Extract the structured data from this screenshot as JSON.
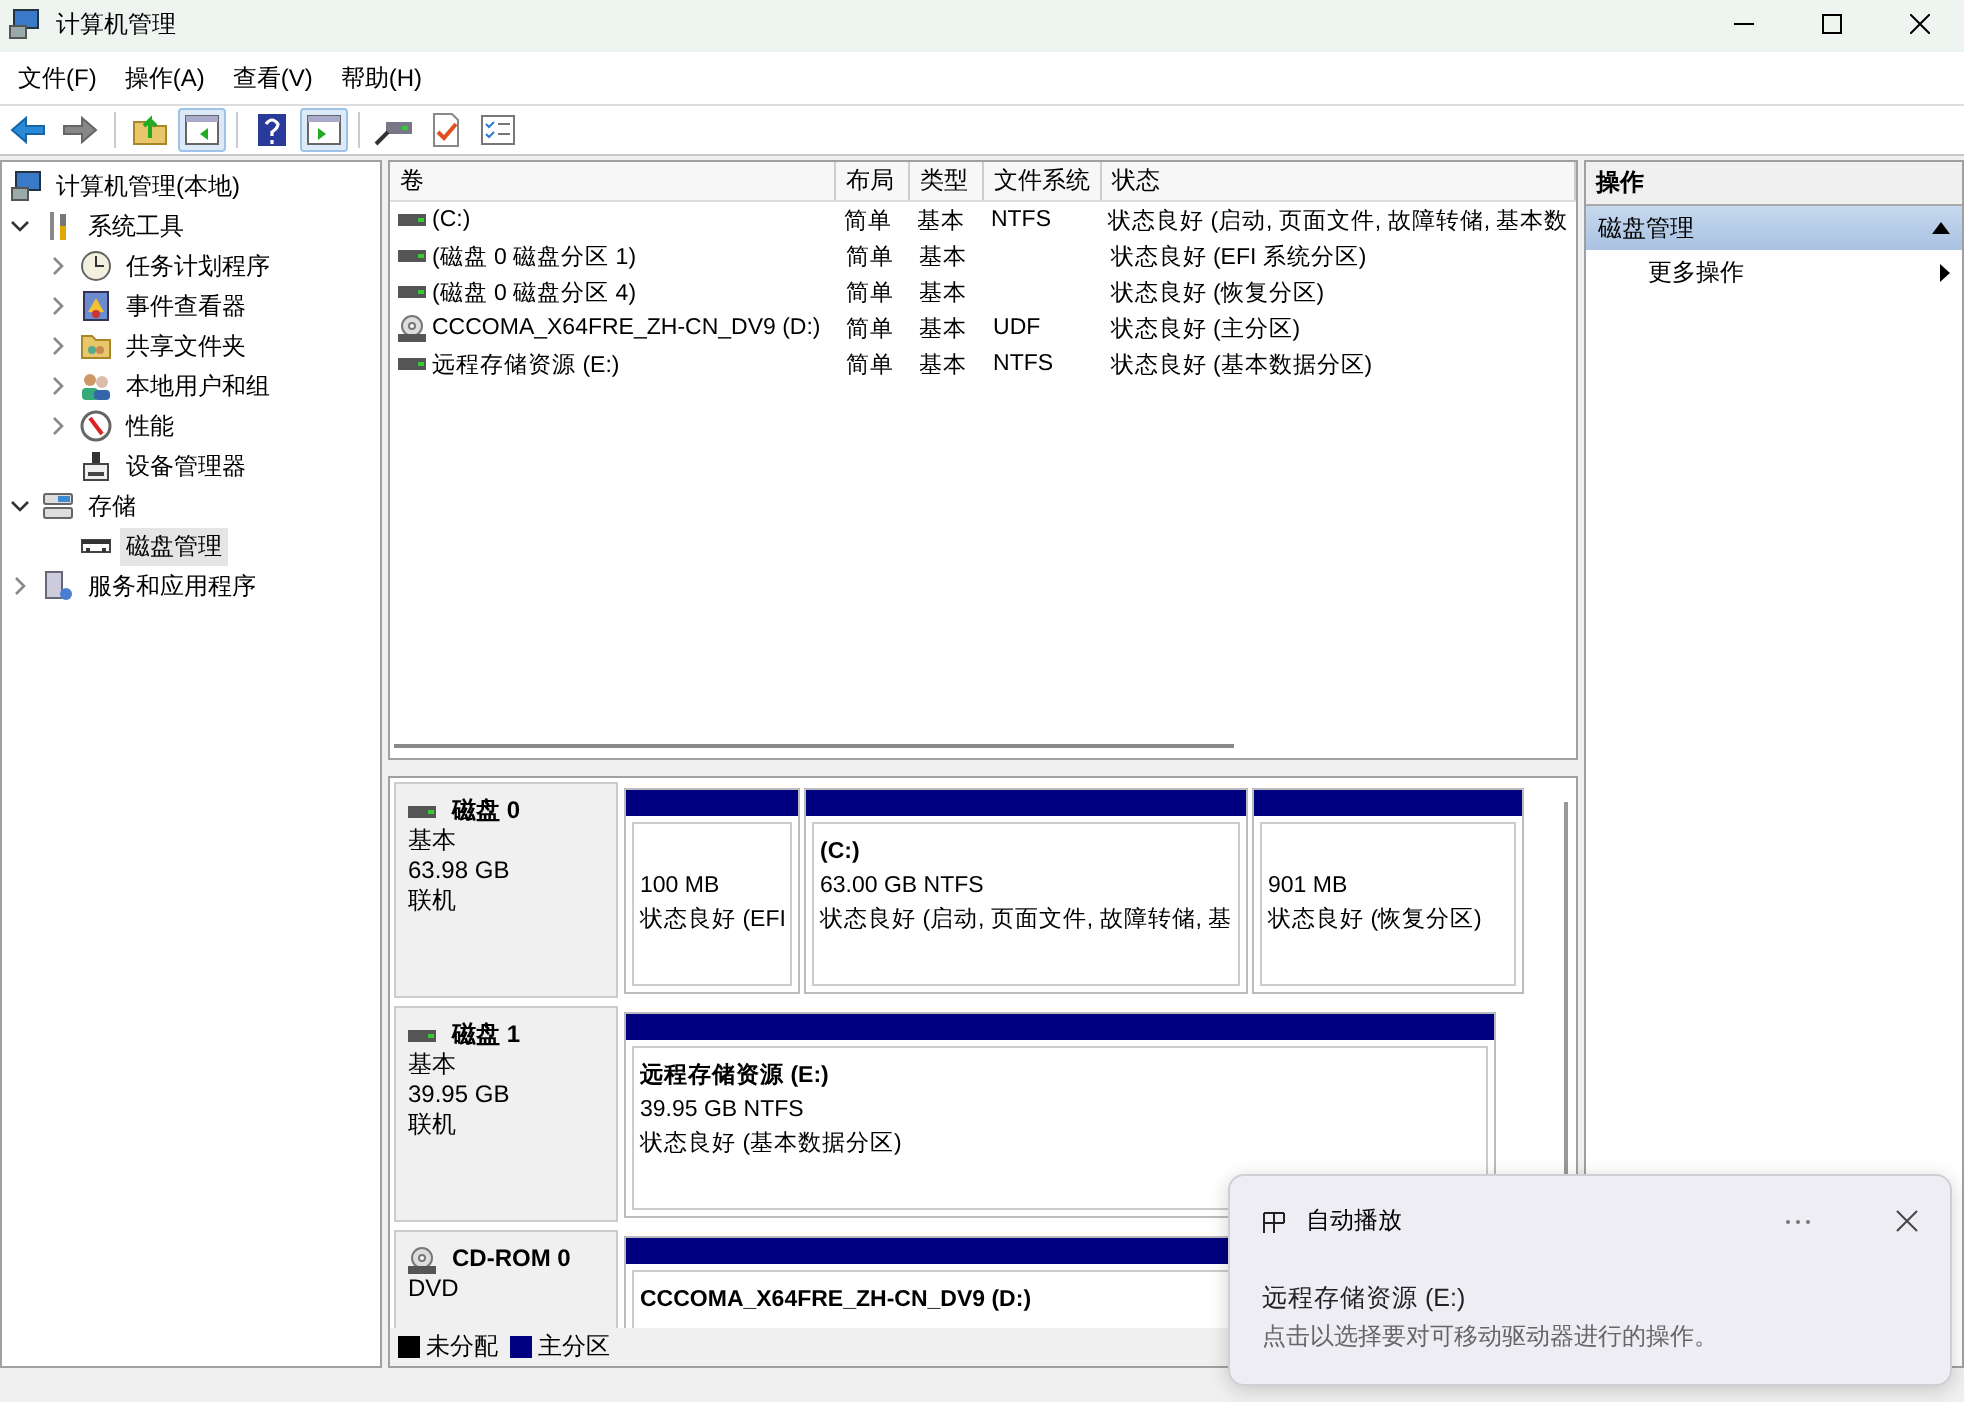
{
  "window": {
    "title": "计算机管理"
  },
  "menu": [
    "文件(F)",
    "操作(A)",
    "查看(V)",
    "帮助(H)"
  ],
  "toolbar": [
    {
      "kind": "back",
      "on": false
    },
    {
      "kind": "forward",
      "on": false
    },
    {
      "kind": "sep"
    },
    {
      "kind": "folder-up",
      "on": false
    },
    {
      "kind": "tree-pane",
      "on": true
    },
    {
      "kind": "sep"
    },
    {
      "kind": "help",
      "on": false
    },
    {
      "kind": "action-pane",
      "on": true
    },
    {
      "kind": "sep"
    },
    {
      "kind": "connect",
      "on": false
    },
    {
      "kind": "check-doc",
      "on": false
    },
    {
      "kind": "checklist",
      "on": false
    }
  ],
  "tree": [
    {
      "label": "计算机管理(本地)",
      "kind": "computer",
      "selected": false,
      "children": [
        {
          "label": "系统工具",
          "kind": "tools",
          "selected": false,
          "expanded": true,
          "children": [
            {
              "label": "任务计划程序",
              "kind": "clock",
              "selected": false,
              "expanded": false
            },
            {
              "label": "事件查看器",
              "kind": "log",
              "selected": false,
              "expanded": false
            },
            {
              "label": "共享文件夹",
              "kind": "folder",
              "selected": false,
              "expanded": false
            },
            {
              "label": "本地用户和组",
              "kind": "users",
              "selected": false,
              "expanded": false
            },
            {
              "label": "性能",
              "kind": "gauge",
              "selected": false,
              "expanded": false
            },
            {
              "label": "设备管理器",
              "kind": "device",
              "selected": false
            }
          ]
        },
        {
          "label": "存储",
          "kind": "storage",
          "selected": false,
          "expanded": true,
          "children": [
            {
              "label": "磁盘管理",
              "kind": "disk",
              "selected": true
            }
          ]
        },
        {
          "label": "服务和应用程序",
          "kind": "services",
          "selected": false,
          "expanded": false
        }
      ]
    }
  ],
  "table": {
    "columns": [
      "卷",
      "布局",
      "类型",
      "文件系统",
      "状态"
    ],
    "rows": [
      {
        "kind": "disk",
        "cells": [
          " (C:)",
          "简单",
          "基本",
          "NTFS",
          "状态良好 (启动, 页面文件, 故障转储, 基本数"
        ]
      },
      {
        "kind": "disk",
        "cells": [
          "(磁盘 0 磁盘分区 1)",
          "简单",
          "基本",
          "",
          "状态良好 (EFI 系统分区)"
        ]
      },
      {
        "kind": "disk",
        "cells": [
          "(磁盘 0 磁盘分区 4)",
          "简单",
          "基本",
          "",
          "状态良好 (恢复分区)"
        ]
      },
      {
        "kind": "cd",
        "cells": [
          "CCCOMA_X64FRE_ZH-CN_DV9 (D:)",
          "简单",
          "基本",
          "UDF",
          "状态良好 (主分区)"
        ]
      },
      {
        "kind": "disk",
        "cells": [
          "远程存储资源 (E:)",
          "简单",
          "基本",
          "NTFS",
          "状态良好 (基本数据分区)"
        ]
      }
    ]
  },
  "disks": [
    {
      "kind": "disk",
      "name": "磁盘 0",
      "lines": [
        "基本",
        "63.98 GB",
        "联机"
      ],
      "partitions": [
        {
          "kind": "primary",
          "lines": [
            "100 MB",
            "状态良好 (EFI"
          ]
        },
        {
          "kind": "primary",
          "label": "(C:)",
          "lines": [
            "63.00 GB NTFS",
            "状态良好 (启动, 页面文件, 故障转储, 基"
          ]
        },
        {
          "kind": "primary",
          "lines": [
            "901 MB",
            "状态良好 (恢复分区)"
          ]
        }
      ]
    },
    {
      "kind": "disk",
      "name": "磁盘 1",
      "lines": [
        "基本",
        "39.95 GB",
        "联机"
      ],
      "partitions": [
        {
          "kind": "primary",
          "label": "远程存储资源  (E:)",
          "lines": [
            "39.95 GB NTFS",
            "状态良好 (基本数据分区)"
          ]
        }
      ]
    },
    {
      "kind": "cd",
      "name": "CD-ROM 0",
      "lines": [
        "DVD"
      ],
      "partitions": [
        {
          "kind": "primary",
          "label": "CCCOMA_X64FRE_ZH-CN_DV9  (D:)"
        }
      ]
    }
  ],
  "legend": [
    {
      "label": "未分配",
      "color": "#000000"
    },
    {
      "label": "主分区",
      "color": "#000080"
    }
  ],
  "actions": {
    "title": "操作",
    "section": "磁盘管理",
    "items": [
      "更多操作"
    ]
  },
  "toast": {
    "title": "自动播放",
    "heading": "远程存储资源 (E:)",
    "body": "点击以选择要对可移动驱动器进行的操作。"
  }
}
